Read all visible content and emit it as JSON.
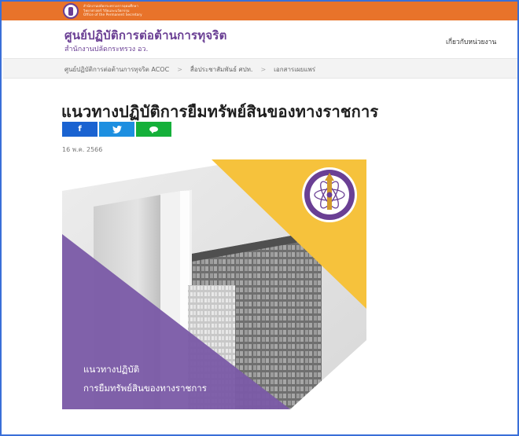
{
  "gov_bar": {
    "lines": [
      "สำนักงานปลัดกระทรวงการอุดมศึกษา",
      "วิทยาศาสตร์ วิจัยและนวัตกรรม",
      "Office of the Permanent Secretary"
    ]
  },
  "header": {
    "site_title": "ศูนย์ปฏิบัติการต่อต้านการทุจริต",
    "site_subtitle": "สำนักงานปลัดกระทรวง อว.",
    "about_link": "เกี่ยวกับหน่วยงาน"
  },
  "breadcrumb": {
    "items": [
      "ศูนย์ปฏิบัติการต่อต้านการทุจริต ACOC",
      "สื่อประชาสัมพันธ์ ศปท.",
      "เอกสารเผยแพร่"
    ],
    "separator": ">"
  },
  "article": {
    "title": "แนวทางปฏิบัติการยืมทรัพย์สินของทางราชการ",
    "date": "16 พ.ค. 2566",
    "share": {
      "facebook": "f",
      "twitter": "🐦",
      "line": ""
    },
    "cover": {
      "caption_line1": "แนวทางปฏิบัติ",
      "caption_line2": "การยืมทรัพย์สินของทางราชการ",
      "colors": {
        "purple": "#7a5aa6",
        "yellow": "#f6c23c",
        "seal_purple": "#6a3f94"
      }
    }
  }
}
